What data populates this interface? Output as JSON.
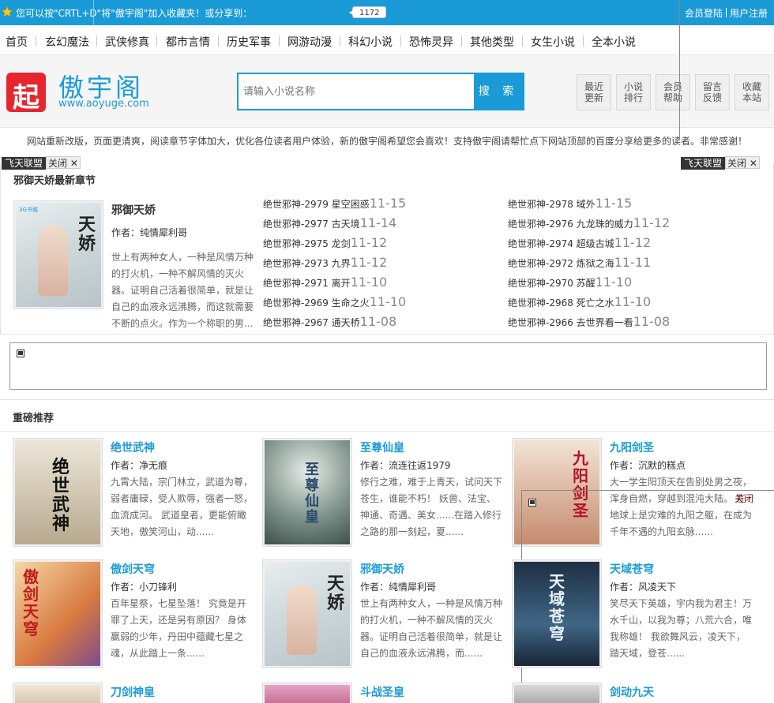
{
  "topbar": {
    "fav_text": "您可以按\"CRTL+D\"将\"傲宇阁\"加入收藏夹！或分享到：",
    "share_count": "1172",
    "login": "会员登陆",
    "register": "用户注册"
  },
  "nav": [
    "首页",
    "玄幻魔法",
    "武侠修真",
    "都市言情",
    "历史军事",
    "网游动漫",
    "科幻小说",
    "恐怖灵异",
    "其他类型",
    "女生小说",
    "全本小说"
  ],
  "header": {
    "logo_glyph": "起",
    "logo_title": "傲宇阁",
    "logo_url": "www.aoyuge.com",
    "search_placeholder": "请输入小说名称",
    "search_button": "搜 索",
    "quick_links": [
      {
        "line1": "最近",
        "line2": "更新"
      },
      {
        "line1": "小说",
        "line2": "排行"
      },
      {
        "line1": "会员",
        "line2": "帮助"
      },
      {
        "line1": "留言",
        "line2": "反馈"
      },
      {
        "line1": "收藏",
        "line2": "本站"
      }
    ]
  },
  "notice": "网站重新改版，页面更清爽，阅读章节字体加大，优化各位读者用户体验，新的傲宇阁希望您会喜欢！支持傲宇阁请帮忙点下网站顶部的百度分享给更多的读者。非常感谢！",
  "ads": {
    "tag": "飞天联盟",
    "close": "关闭"
  },
  "latest": {
    "section_title": "邪御天娇最新章节",
    "book": {
      "title": "邪御天娇",
      "author": "作者：纯情犀利哥",
      "desc": "世上有两种女人，一种是风情万种的打火机，一种不解风情的灭火器。证明自己活着很简单，就是让自己的血液永远沸腾，而这就需要不断的点火。作为一个称职的男...",
      "cover_text": "天娇",
      "cover_logo": "3G书城"
    },
    "chapters": [
      {
        "name": "绝世邪神-2979 星空困惑",
        "date": "11-15"
      },
      {
        "name": "绝世邪神-2978 域外",
        "date": "11-15"
      },
      {
        "name": "绝世邪神-2977 古天境",
        "date": "11-14"
      },
      {
        "name": "绝世邪神-2976 九龙珠的威力",
        "date": "11-12"
      },
      {
        "name": "绝世邪神-2975 龙剑",
        "date": "11-12"
      },
      {
        "name": "绝世邪神-2974 超级古城",
        "date": "11-12"
      },
      {
        "name": "绝世邪神-2973 九界",
        "date": "11-12"
      },
      {
        "name": "绝世邪神-2972 炼狱之海",
        "date": "11-11"
      },
      {
        "name": "绝世邪神-2971 离开",
        "date": "11-10"
      },
      {
        "name": "绝世邪神-2970 苏醒",
        "date": "11-10"
      },
      {
        "name": "绝世邪神-2969 生命之火",
        "date": "11-10"
      },
      {
        "name": "绝世邪神-2968 死亡之水",
        "date": "11-10"
      },
      {
        "name": "绝世邪神-2967 通天桥",
        "date": "11-08"
      },
      {
        "name": "绝世邪神-2966 去世界看一看",
        "date": "11-08"
      }
    ]
  },
  "recommend": {
    "section_title": "重磅推荐",
    "books": [
      {
        "title": "绝世武神",
        "author": "作者：净无痕",
        "desc": "九霄大陆，宗门林立，武道为尊，弱者庸碌，受人欺辱，强者一怒，血流成河。 武道皇者，更能俯瞰天地，傲笑河山，动......",
        "cover_text": "绝世武神",
        "cover_color": "#d9d2c3"
      },
      {
        "title": "至尊仙皇",
        "author": "作者：流连往返1979",
        "desc": "修行之难，难于上青天，试问天下苍生，谁能不朽！ 妖兽、法宝、神通、奇遇、美女......在踏入修行之路的那一刻起，夏......",
        "cover_text": "至尊仙皇",
        "cover_color": "#6c7f78"
      },
      {
        "title": "九阳剑圣",
        "author": "作者：沉默的糕点",
        "desc": "大一学生阳顶天在告别处男之夜，浑身自燃，穿越到混沌大陆。 在地球上是灾难的九阳之躯，在成为千年不遇的九阳玄脉......",
        "cover_text": "九阳剑圣",
        "cover_color": "#c9a28a",
        "close_label": "关闭"
      },
      {
        "title": "傲剑天穹",
        "author": "作者：小刀锋利",
        "desc": "百年星祭，七星坠落！ 究竟是开罪了上天，还是另有原因？ 身体羸弱的少年，丹田中蕴藏七星之魂，从此踏上一条......",
        "cover_text": "傲剑天穹",
        "cover_color": "#e4a260"
      },
      {
        "title": "邪御天娇",
        "author": "作者：纯情犀利哥",
        "desc": "世上有两种女人，一种是风情万种的打火机，一种不解风情的灭火器。证明自己活着很简单，就是让自己的血液永远沸腾，而......",
        "cover_text": "天娇",
        "cover_color": "#dfe3e3"
      },
      {
        "title": "天域苍穹",
        "author": "作者：风凌天下",
        "desc": "笑尽天下英雄，宇内我为君主！万水千山，以我为尊；八荒六合，唯我称雄！ 我欲舞风云，凌天下，踏天域，登苍......",
        "cover_text": "天域苍穹",
        "cover_color": "#2f4a63"
      },
      {
        "title": "刀剑神皇",
        "author": "",
        "desc": "",
        "cover_text": "",
        "cover_color": "#c7b59a"
      },
      {
        "title": "斗战圣皇",
        "author": "",
        "desc": "",
        "cover_text": "",
        "cover_color": "#b33f6a"
      },
      {
        "title": "剑动九天",
        "author": "",
        "desc": "",
        "cover_text": "",
        "cover_color": "#8b8b8b"
      }
    ]
  },
  "colors": {
    "accent": "#1a9bd7",
    "logo_red": "#e6262e"
  }
}
